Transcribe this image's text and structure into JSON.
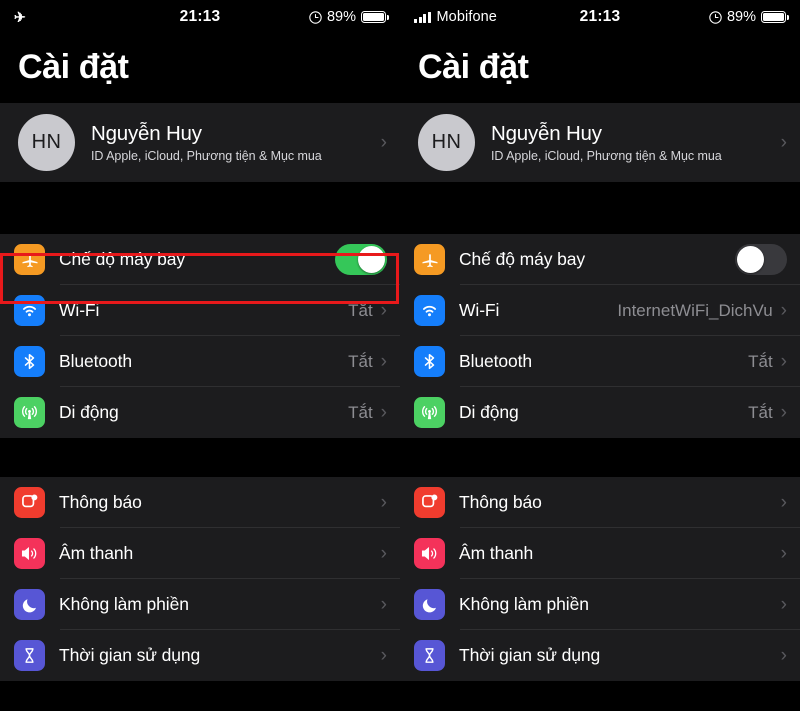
{
  "status_bar": {
    "left": {
      "airplane_icon": "airplane-icon",
      "time": "21:13",
      "alarm_icon": "alarm-clock-icon",
      "battery_percent": "89%",
      "battery_icon": "battery-icon"
    },
    "right": {
      "signal_icon": "signal-bars-icon",
      "carrier": "Mobifone",
      "time": "21:13",
      "alarm_icon": "alarm-clock-icon",
      "battery_percent": "89%",
      "battery_icon": "battery-icon"
    }
  },
  "page_title": "Cài đặt",
  "profile": {
    "initials": "HN",
    "name": "Nguyễn Huy",
    "subtitle": "ID Apple, iCloud, Phương tiện & Mục mua",
    "chevron": "›"
  },
  "colors": {
    "airplane": "#f59a23",
    "wifi": "#157efb",
    "bluetooth": "#157efb",
    "cellular": "#4cd163",
    "notifications": "#f03c2e",
    "sounds": "#f4325a",
    "do_not_disturb": "#5756d5",
    "screen_time": "#5756d5",
    "toggle_on": "#35c759",
    "toggle_off": "#39393d",
    "highlight_border": "#e8191b",
    "group_background": "#1c1c1e",
    "page_background": "#000000"
  },
  "left_panel": {
    "connectivity": [
      {
        "icon": "airplane-icon",
        "label": "Chế độ máy bay",
        "control": "toggle",
        "toggle_state": "on",
        "highlighted": true
      },
      {
        "icon": "wifi-icon",
        "label": "Wi-Fi",
        "control": "value",
        "value": "Tắt",
        "chevron": "›"
      },
      {
        "icon": "bluetooth-icon",
        "label": "Bluetooth",
        "control": "value",
        "value": "Tắt",
        "chevron": "›"
      },
      {
        "icon": "cellular-icon",
        "label": "Di động",
        "control": "value",
        "value": "Tắt",
        "chevron": "›"
      }
    ],
    "general": [
      {
        "icon": "notifications-icon",
        "label": "Thông báo",
        "control": "chevron",
        "chevron": "›"
      },
      {
        "icon": "sounds-icon",
        "label": "Âm thanh",
        "control": "chevron",
        "chevron": "›"
      },
      {
        "icon": "moon-icon",
        "label": "Không làm phiền",
        "control": "chevron",
        "chevron": "›"
      },
      {
        "icon": "hourglass-icon",
        "label": "Thời gian sử dụng",
        "control": "chevron",
        "chevron": "›"
      }
    ]
  },
  "right_panel": {
    "connectivity": [
      {
        "icon": "airplane-icon",
        "label": "Chế độ máy bay",
        "control": "toggle",
        "toggle_state": "off",
        "highlighted": false
      },
      {
        "icon": "wifi-icon",
        "label": "Wi-Fi",
        "control": "value",
        "value": "InternetWiFi_DichVu",
        "chevron": "›"
      },
      {
        "icon": "bluetooth-icon",
        "label": "Bluetooth",
        "control": "value",
        "value": "Tắt",
        "chevron": "›"
      },
      {
        "icon": "cellular-icon",
        "label": "Di động",
        "control": "value",
        "value": "Tắt",
        "chevron": "›"
      }
    ],
    "general": [
      {
        "icon": "notifications-icon",
        "label": "Thông báo",
        "control": "chevron",
        "chevron": "›"
      },
      {
        "icon": "sounds-icon",
        "label": "Âm thanh",
        "control": "chevron",
        "chevron": "›"
      },
      {
        "icon": "moon-icon",
        "label": "Không làm phiền",
        "control": "chevron",
        "chevron": "›"
      },
      {
        "icon": "hourglass-icon",
        "label": "Thời gian sử dụng",
        "control": "chevron",
        "chevron": "›"
      }
    ]
  }
}
